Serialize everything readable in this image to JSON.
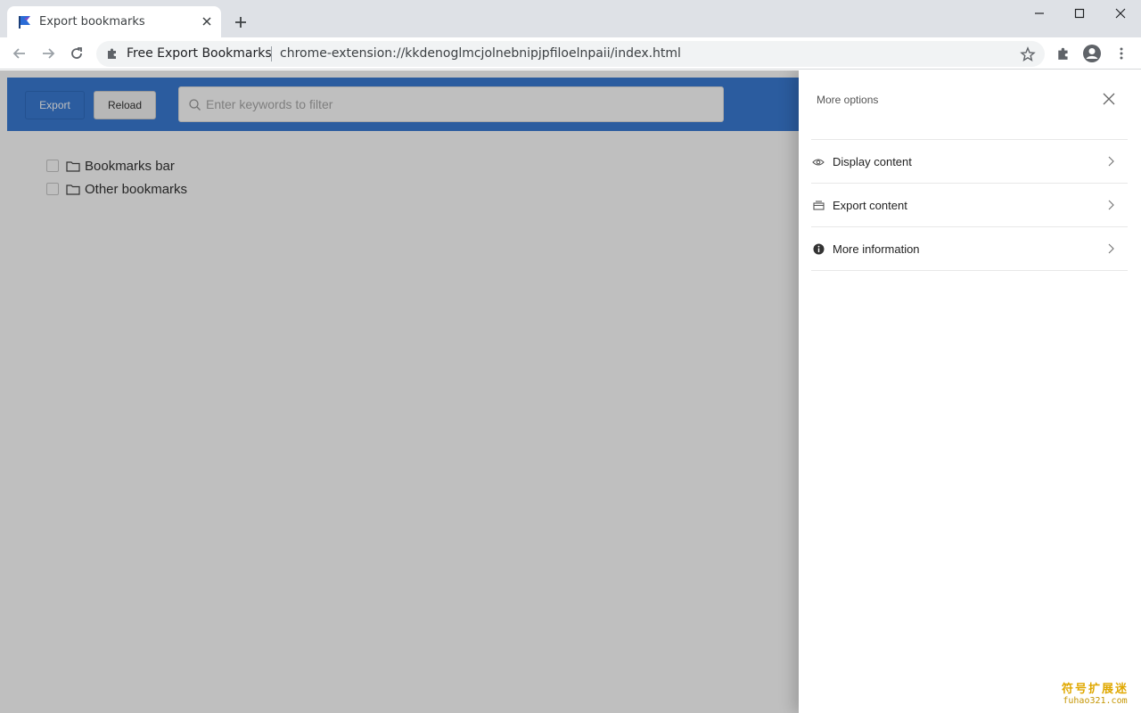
{
  "browser": {
    "tab": {
      "title": "Export bookmarks"
    },
    "omnibox": {
      "site_name": "Free Export Bookmarks",
      "url": "chrome-extension://kkdenoglmcjolnebnipjpfiloelnpaii/index.html"
    }
  },
  "app": {
    "export_label": "Export",
    "reload_label": "Reload",
    "search": {
      "placeholder": "Enter keywords to filter",
      "value": ""
    },
    "tree": [
      {
        "label": "Bookmarks bar",
        "icon": "folder-icon",
        "checked": false
      },
      {
        "label": "Other bookmarks",
        "icon": "folder-icon",
        "checked": false
      }
    ]
  },
  "drawer": {
    "title": "More options",
    "items": [
      {
        "label": "Display content",
        "icon": "eye-icon"
      },
      {
        "label": "Export content",
        "icon": "export-icon"
      },
      {
        "label": "More information",
        "icon": "info-icon"
      }
    ]
  },
  "watermark": {
    "cn": "符号扩展迷",
    "en": "fuhao321.com"
  },
  "colors": {
    "accent": "#3a7bd5",
    "tabstrip": "#dee1e6",
    "overlay": "rgba(0,0,0,0.25)"
  }
}
